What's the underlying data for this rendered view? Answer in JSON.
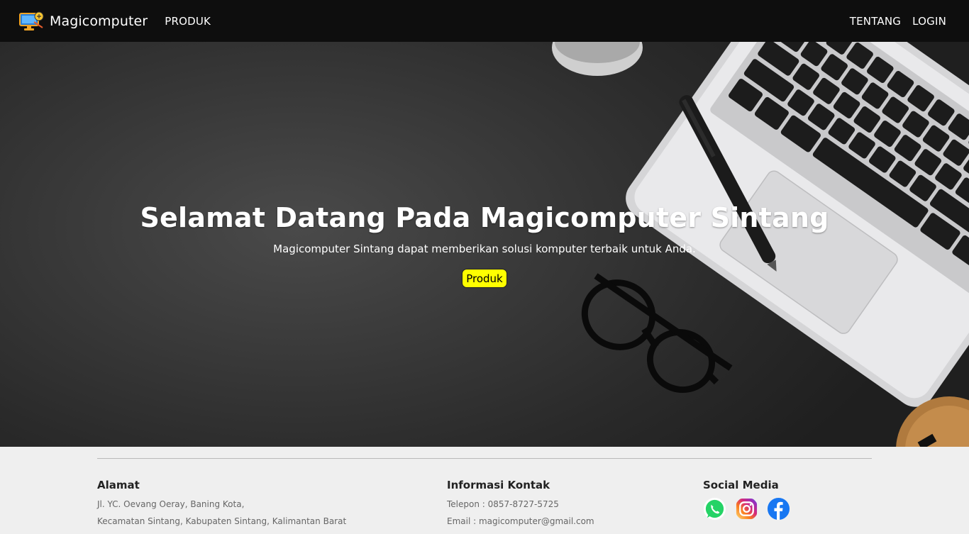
{
  "navbar": {
    "brand": "Magicomputer",
    "logo_icon": "computer-logo-icon",
    "left_links": [
      "PRODUK"
    ],
    "right_links": [
      "TENTANG",
      "LOGIN"
    ]
  },
  "hero": {
    "title": "Selamat Datang Pada Magicomputer Sintang",
    "subtitle": "Magicomputer Sintang dapat memberikan solusi komputer terbaik untuk Anda.",
    "button_label": "Produk",
    "button_color": "#ffff00"
  },
  "footer": {
    "alamat": {
      "heading": "Alamat",
      "line1": "Jl. YC. Oevang Oeray, Baning Kota,",
      "line2": "Kecamatan Sintang, Kabupaten Sintang, Kalimantan Barat"
    },
    "kontak": {
      "heading": "Informasi Kontak",
      "telepon": "Telepon : 0857-8727-5725",
      "email": "Email : magicomputer@gmail.com"
    },
    "social": {
      "heading": "Social Media",
      "icons": [
        "whatsapp-icon",
        "instagram-icon",
        "facebook-icon"
      ]
    }
  }
}
